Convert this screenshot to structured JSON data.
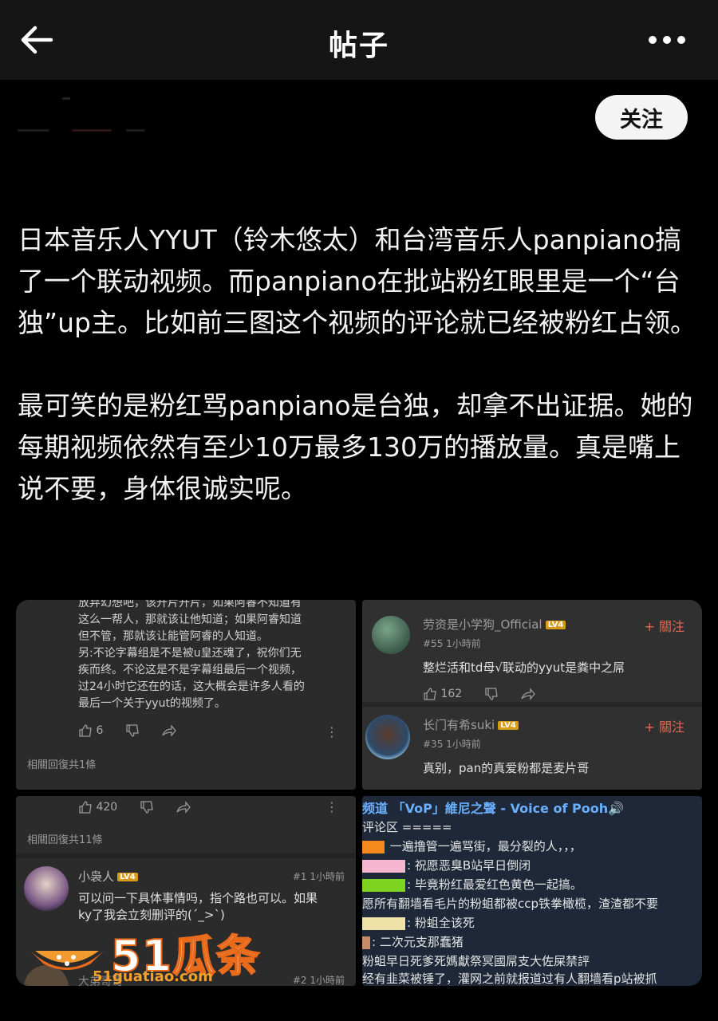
{
  "header": {
    "title": "帖子",
    "back_icon": "arrow-left-icon",
    "more_icon": "more-horizontal-icon"
  },
  "follow_button": {
    "label": "关注"
  },
  "post": {
    "paragraphs": [
      "日本音乐人YYUT（铃木悠太）和台湾音乐人panpiano搞了一个联动视频。而panpiano在批站粉红眼里是一个“台独”up主。比如前三图这个视频的评论就已经被粉红占领。",
      "最可笑的是粉红骂panpiano是台独，却拿不出证据。她的每期视频依然有至少10万最多130万的播放量。真是嘴上说不要，身体很诚实呢。"
    ]
  },
  "images": {
    "img1": {
      "comment_lines": [
        "放弃幻想吧，该开片开片，如果阿睿不知道有",
        "这么一帮人，那就该让他知道；如果阿睿知道",
        "但不管，那就该让能管阿睿的人知道。",
        "另:不论字幕组是不是被u皇还魂了，祝你们无",
        "疾而终。不论这是不是字幕组最后一个视频，",
        "过24小时它还在的话，这大概会是许多人看的",
        "最后一个关于yyut的视频了。"
      ],
      "likes": "6",
      "replies": "相關回復共1條"
    },
    "img2": {
      "comments": [
        {
          "user": "劳资是小学狗_Official",
          "level": "LV4",
          "follow": "+ 關注",
          "meta": "#55  1小時前",
          "text": "整烂活和td母√联动的yyut是粪中之屌",
          "likes": "162"
        },
        {
          "user": "长门有希suki",
          "level": "LV4",
          "follow": "+ 關注",
          "meta": "#35  1小時前",
          "text": "真别，pan的真爱粉都是麦片哥"
        }
      ]
    },
    "img3": {
      "likes": "420",
      "replies": "相關回復共11條",
      "comments": [
        {
          "user": "小袅人",
          "level": "LV4",
          "meta": "#1  1小時前",
          "lines": [
            "可以问一下具体事情吗，指个路也可以。如果",
            "ky了我会立刻删评的(´_>`)"
          ]
        },
        {
          "user": "大弟哥哥",
          "meta": "#2  1小時前"
        }
      ]
    },
    "img4": {
      "title": "频道 「VoP」維尼之聲 - Voice of Pooh🔊",
      "section": "评论区 =====",
      "lines": [
        {
          "color": "#f58a1c",
          "text": "一遍撸管一遍骂街，最分裂的人，，，"
        },
        {
          "color": "#f7b6d0",
          "text": "祝愿恶臭B站早日倒闭"
        },
        {
          "color": "#7ed321",
          "text": "毕竟粉红最爱红色黄色一起搞。"
        },
        {
          "color": "",
          "text": "愿所有翻墙看毛片的粉蛆都被ccp铁拳橄榄，渣渣都不要"
        },
        {
          "color": "#efe2a8",
          "text": "粉蛆全该死"
        },
        {
          "color": "#c98a6a",
          "text": "二次元支那蠢猪"
        },
        {
          "color": "",
          "text": "粉蛆早日死爹死媽獻祭冥國屌支大佐屎禁評"
        },
        {
          "color": "",
          "text": "经有韭菜被锤了，灌网之前就报道过有人翻墙看p站被抓"
        }
      ]
    }
  },
  "watermark": {
    "brand": "51瓜条",
    "url": "51guatiao.com"
  },
  "colors": {
    "background": "#000000",
    "header": "#151515",
    "follow_bg": "#f4f4f4",
    "accent_orange": "#e86a1a"
  }
}
